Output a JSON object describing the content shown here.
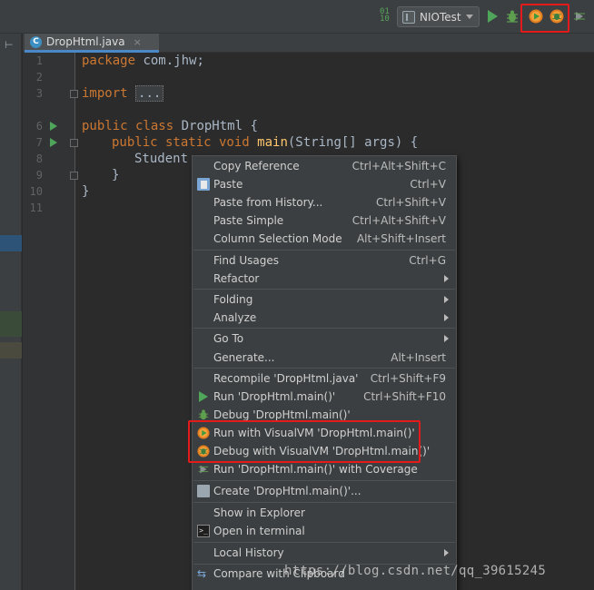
{
  "toolbar": {
    "run_config_label": "NIOTest",
    "icons": [
      "build-icon",
      "run-icon",
      "debug-icon",
      "run-with-visualvm-icon",
      "debug-with-visualvm-icon",
      "profile-icon"
    ],
    "highlight_color": "#e31b1b"
  },
  "tab": {
    "label": "DropHtml.java",
    "class_glyph": "C",
    "close": "×"
  },
  "editor": {
    "line_numbers": [
      "1",
      "2",
      "3",
      "6",
      "7",
      "8",
      "9",
      "10",
      "11"
    ],
    "lines": {
      "l1_kw": "package",
      "l1_rest": " com.jhw;",
      "l3_kw": "import",
      "l3_fold": "...",
      "l6_kw": "public class",
      "l6_rest": " DropHtml {",
      "l7_kw": "public static void",
      "l7_fn": "main",
      "l7_rest": "(String[] args) {",
      "l8_text": "Student",
      "l9_text": "}",
      "l10_text": "}"
    }
  },
  "context_menu": {
    "items": [
      {
        "label": "Copy Reference",
        "shortcut": "Ctrl+Alt+Shift+C"
      },
      {
        "label": "Paste",
        "shortcut": "Ctrl+V",
        "icon": "paste-icon"
      },
      {
        "label": "Paste from History...",
        "shortcut": "Ctrl+Shift+V"
      },
      {
        "label": "Paste Simple",
        "shortcut": "Ctrl+Alt+Shift+V"
      },
      {
        "label": "Column Selection Mode",
        "shortcut": "Alt+Shift+Insert"
      },
      {
        "label": "Find Usages",
        "shortcut": "Ctrl+G"
      },
      {
        "label": "Refactor",
        "submenu": true
      },
      {
        "label": "Folding",
        "submenu": true
      },
      {
        "label": "Analyze",
        "submenu": true
      },
      {
        "label": "Go To",
        "submenu": true
      },
      {
        "label": "Generate...",
        "shortcut": "Alt+Insert"
      },
      {
        "label": "Recompile 'DropHtml.java'",
        "shortcut": "Ctrl+Shift+F9"
      },
      {
        "label": "Run 'DropHtml.main()'",
        "shortcut": "Ctrl+Shift+F10",
        "icon": "run-icon"
      },
      {
        "label": "Debug 'DropHtml.main()'",
        "icon": "debug-icon"
      },
      {
        "label": "Run with VisualVM 'DropHtml.main()'",
        "icon": "run-with-visualvm-icon"
      },
      {
        "label": "Debug with VisualVM 'DropHtml.main()'",
        "icon": "debug-with-visualvm-icon"
      },
      {
        "label": "Run 'DropHtml.main()' with Coverage",
        "icon": "coverage-icon"
      },
      {
        "label": "Create 'DropHtml.main()'...",
        "icon": "create-config-icon"
      },
      {
        "label": "Show in Explorer"
      },
      {
        "label": "Open in terminal",
        "icon": "terminal-icon"
      },
      {
        "label": "Local History",
        "submenu": true
      },
      {
        "label": "Compare with Clipboard",
        "icon": "compare-icon"
      }
    ]
  },
  "watermark": "https://blog.csdn.net/qq_39615245"
}
